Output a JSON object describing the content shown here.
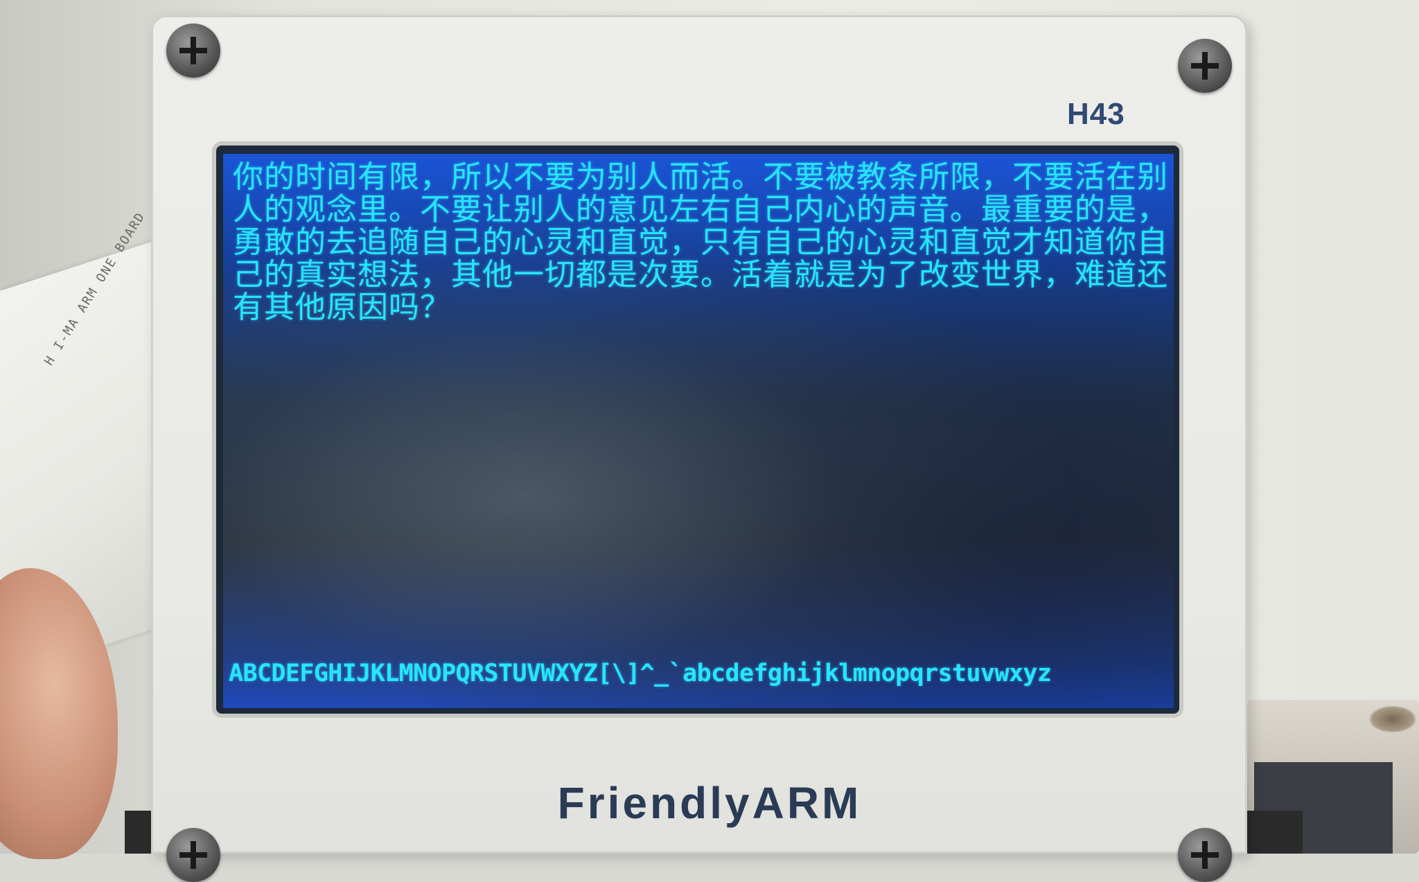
{
  "device": {
    "model_label": "H43",
    "brand": "FriendlyARM",
    "cable_text": "H I-MA ARM ONE BOARD"
  },
  "lcd": {
    "paragraph": "你的时间有限，所以不要为别人而活。不要被教条所限，不要活在别人的观念里。不要让别人的意见左右自己内心的声音。最重要的是，勇敢的去追随自己的心灵和直觉，只有自己的心灵和直觉才知道你自己的真实想法，其他一切都是次要。活着就是为了改变世界，难道还有其他原因吗？",
    "charset_line": "ABCDEFGHIJKLMNOPQRSTUVWXYZ[\\]^_`abcdefghijklmnopqrstuvwxyz"
  },
  "colors": {
    "lcd_text": "#25e6ff",
    "lcd_background": "#1a54d6",
    "panel": "#ededea",
    "brand_text": "#2a3b55",
    "model_text": "#2f4a73"
  }
}
